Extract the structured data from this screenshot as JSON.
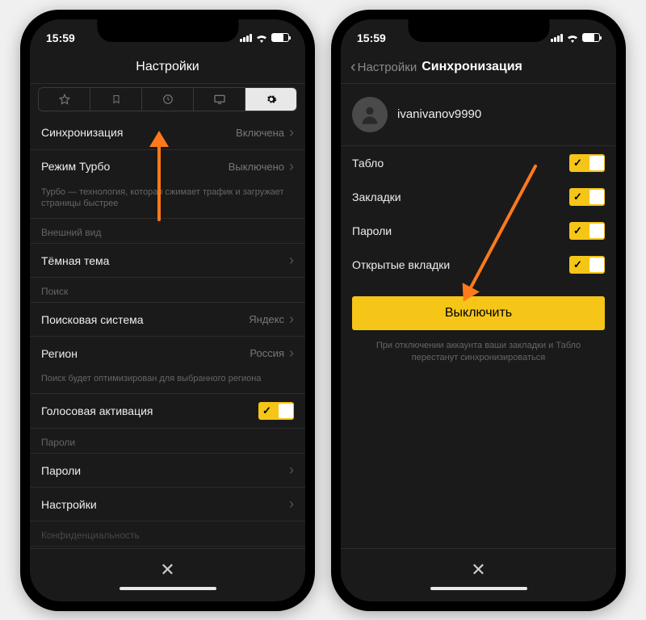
{
  "status": {
    "time": "15:59"
  },
  "left": {
    "title": "Настройки",
    "rows": {
      "sync": {
        "label": "Синхронизация",
        "value": "Включена"
      },
      "turbo": {
        "label": "Режим Турбо",
        "value": "Выключено"
      },
      "turbo_desc": "Турбо — технология, которая сжимает трафик и загружает страницы быстрее",
      "appearance_h": "Внешний вид",
      "dark_theme": "Тёмная тема",
      "search_h": "Поиск",
      "search_engine": {
        "label": "Поисковая система",
        "value": "Яндекс"
      },
      "region": {
        "label": "Регион",
        "value": "Россия"
      },
      "search_desc": "Поиск будет оптимизирован для выбранного региона",
      "voice": "Голосовая активация",
      "passwords_h": "Пароли",
      "passwords": "Пароли",
      "settings": "Настройки",
      "privacy": "Конфиденциальность"
    }
  },
  "right": {
    "back": "Настройки",
    "title": "Синхронизация",
    "username": "ivanivanov9990",
    "items": {
      "tablo": "Табло",
      "bookmarks": "Закладки",
      "passwords": "Пароли",
      "tabs": "Открытые вкладки"
    },
    "button": "Выключить",
    "note": "При отключении аккаунта ваши закладки и Табло перестанут синхронизироваться"
  }
}
